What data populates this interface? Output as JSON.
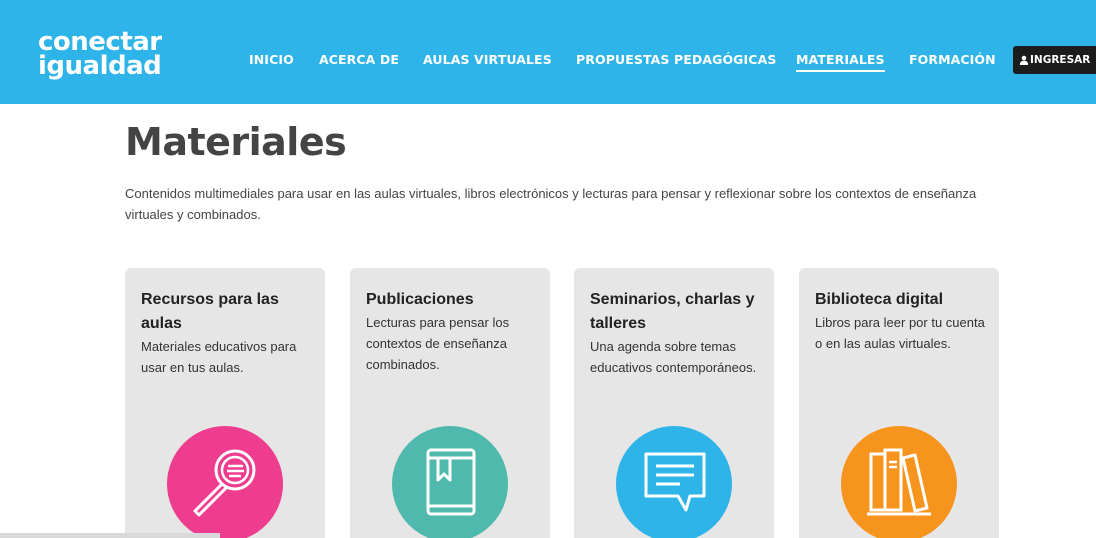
{
  "brand": {
    "line1": "conectar",
    "line2": "igualdad"
  },
  "nav": {
    "items": [
      {
        "label": "INICIO"
      },
      {
        "label": "ACERCA DE"
      },
      {
        "label": "AULAS VIRTUALES"
      },
      {
        "label": "PROPUESTAS PEDAGÓGICAS"
      },
      {
        "label": "MATERIALES",
        "active": true
      },
      {
        "label": "FORMACIÓN"
      }
    ],
    "login_label": "INGRESAR"
  },
  "page": {
    "title": "Materiales",
    "intro": "Contenidos multimediales para usar en las aulas virtuales, libros electrónicos y lecturas para pensar y reflexionar sobre los contextos de enseñanza virtuales y combinados."
  },
  "cards": [
    {
      "title": "Recursos para las aulas",
      "description": "Materiales educativos para usar en tus aulas.",
      "color": "#ee3d8f",
      "icon": "magnifier-icon"
    },
    {
      "title": "Publicaciones",
      "description": "Lecturas para pensar los contextos de enseñanza combinados.",
      "color": "#4fb9ad",
      "icon": "book-icon"
    },
    {
      "title": "Seminarios, charlas y talleres",
      "description": "Una agenda sobre temas educativos contemporáneos.",
      "color": "#2fb4e9",
      "icon": "chat-bubble-icon"
    },
    {
      "title": "Biblioteca digital",
      "description": "Libros para leer por tu cuenta o en las aulas virtuales.",
      "color": "#f7941d",
      "icon": "books-icon"
    }
  ],
  "colors": {
    "header": "#2fb4e9",
    "login_bg": "#1c1c1c",
    "card_bg": "#e6e6e6"
  }
}
